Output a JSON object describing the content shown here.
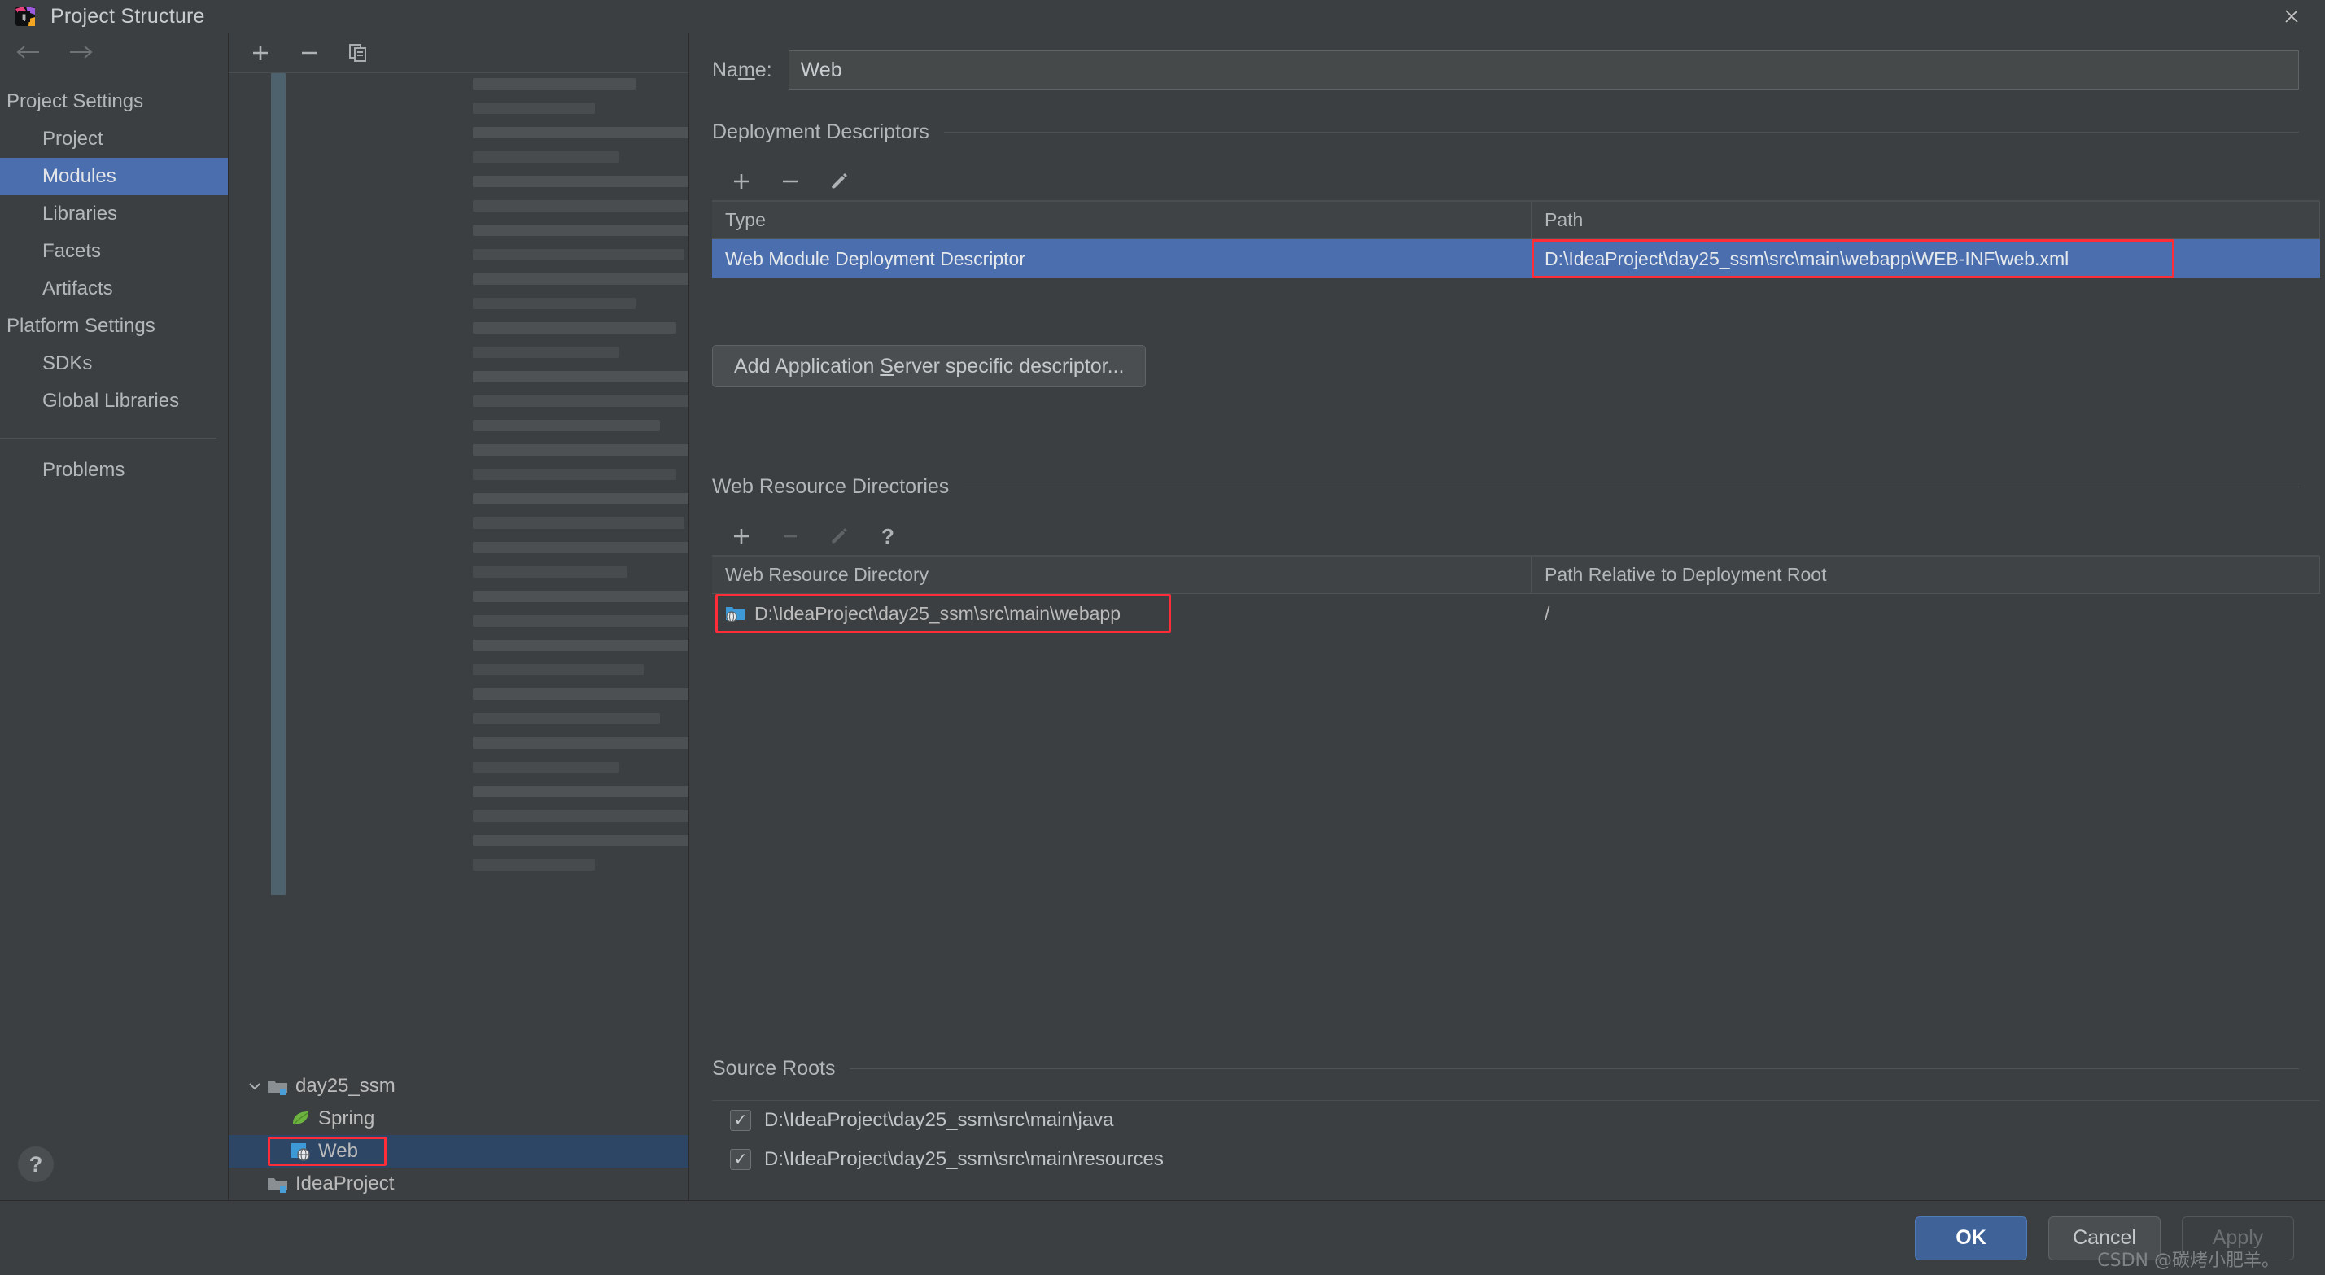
{
  "window": {
    "title": "Project Structure",
    "logo_icon": "intellij-idea-logo-icon",
    "close_icon": "close-icon"
  },
  "sidebar": {
    "back_icon": "arrow-left-icon",
    "forward_icon": "arrow-right-icon",
    "groups": [
      {
        "label": "Project Settings",
        "items": [
          {
            "label": "Project",
            "selected": false
          },
          {
            "label": "Modules",
            "selected": true
          },
          {
            "label": "Libraries",
            "selected": false
          },
          {
            "label": "Facets",
            "selected": false
          },
          {
            "label": "Artifacts",
            "selected": false
          }
        ]
      },
      {
        "label": "Platform Settings",
        "items": [
          {
            "label": "SDKs",
            "selected": false
          },
          {
            "label": "Global Libraries",
            "selected": false
          }
        ]
      }
    ],
    "problems_label": "Problems",
    "help_button": "?"
  },
  "modules_panel": {
    "toolbar": [
      {
        "name": "add-module-button",
        "icon": "plus-icon"
      },
      {
        "name": "remove-module-button",
        "icon": "minus-icon"
      },
      {
        "name": "copy-module-button",
        "icon": "copy-icon"
      }
    ],
    "tree": [
      {
        "label": "day25_ssm",
        "icon": "module-folder-icon",
        "depth": 0,
        "expanded": true,
        "selected": false
      },
      {
        "label": "Spring",
        "icon": "spring-leaf-icon",
        "depth": 1,
        "selected": false
      },
      {
        "label": "Web",
        "icon": "web-facet-icon",
        "depth": 1,
        "selected": true,
        "highlighted": true
      },
      {
        "label": "IdeaProject",
        "icon": "module-folder-icon",
        "depth": 0,
        "selected": false
      }
    ]
  },
  "content": {
    "name": {
      "label_before": "Na",
      "label_mnemonic": "m",
      "label_after": "e:",
      "value": "Web"
    },
    "deployment_descriptors": {
      "title": "Deployment Descriptors",
      "toolbar": [
        {
          "name": "add-descriptor-button",
          "icon": "plus-icon",
          "disabled": false
        },
        {
          "name": "remove-descriptor-button",
          "icon": "minus-icon",
          "disabled": false
        },
        {
          "name": "edit-descriptor-button",
          "icon": "pencil-icon",
          "disabled": false
        }
      ],
      "columns": [
        "Type",
        "Path"
      ],
      "rows": [
        {
          "type": "Web Module Deployment Descriptor",
          "path": "D:\\IdeaProject\\day25_ssm\\src\\main\\webapp\\WEB-INF\\web.xml",
          "selected": true,
          "path_highlighted": true
        }
      ],
      "add_server_descriptor_button": {
        "before": "Add Application ",
        "mnemonic": "S",
        "after": "erver specific descriptor..."
      }
    },
    "web_resource_directories": {
      "title": "Web Resource Directories",
      "toolbar": [
        {
          "name": "add-web-resource-button",
          "icon": "plus-icon",
          "disabled": false
        },
        {
          "name": "remove-web-resource-button",
          "icon": "minus-icon",
          "disabled": true
        },
        {
          "name": "edit-web-resource-button",
          "icon": "pencil-icon",
          "disabled": true
        },
        {
          "name": "help-web-resource-button",
          "icon": "question-icon",
          "disabled": false
        }
      ],
      "columns": [
        "Web Resource Directory",
        "Path Relative to Deployment Root"
      ],
      "rows": [
        {
          "directory": "D:\\IdeaProject\\day25_ssm\\src\\main\\webapp",
          "relative_path": "/",
          "icon": "folder-web-icon",
          "highlighted": true
        }
      ]
    },
    "source_roots": {
      "title": "Source Roots",
      "items": [
        {
          "label": "D:\\IdeaProject\\day25_ssm\\src\\main\\java",
          "checked": true
        },
        {
          "label": "D:\\IdeaProject\\day25_ssm\\src\\main\\resources",
          "checked": true
        }
      ],
      "check_glyph": "✓"
    }
  },
  "footer": {
    "ok_label": "OK",
    "cancel_label": "Cancel",
    "apply_label": "Apply",
    "watermark": "CSDN @碳烤小肥羊。"
  },
  "colors": {
    "accent_selection": "#4b6eaf",
    "tree_selection": "#2e4665",
    "highlight_border": "#ff2d37",
    "primary_button": "#3f6398",
    "window_bg": "#3c3f41"
  }
}
